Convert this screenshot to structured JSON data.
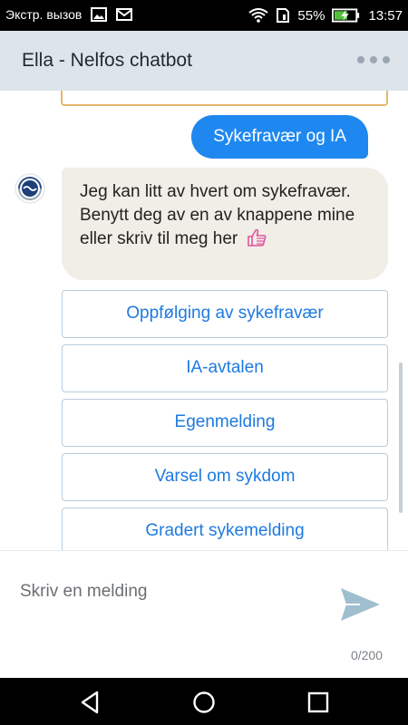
{
  "status_bar": {
    "carrier": "Экстр. вызов",
    "battery_percent": "55%",
    "time": "13:57",
    "icons": [
      "image-icon",
      "mail-icon",
      "wifi-icon",
      "sim-icon",
      "battery-charging-icon"
    ]
  },
  "header": {
    "title": "Ella - Nelfos chatbot",
    "menu_icon": "more-dots-icon"
  },
  "chat": {
    "user_message": "Sykefravær og IA",
    "bot_message": "Jeg kan litt av hvert om sykefravær. Benytt deg av en av knappene mine eller skriv til meg her",
    "bot_emoji": "thumbs-up-icon",
    "quick_replies": [
      "Oppfølging av sykefravær",
      "IA-avtalen",
      "Egenmelding",
      "Varsel om sykdom",
      "Gradert sykemelding"
    ]
  },
  "composer": {
    "placeholder": "Skriv en melding",
    "value": "",
    "counter": "0/200",
    "send_icon": "send-icon"
  },
  "nav_bar": {
    "icons": [
      "back-icon",
      "home-icon",
      "recents-icon"
    ]
  },
  "colors": {
    "accent": "#1e88f0",
    "link": "#1e7ae0",
    "header_bg": "#dde4ea",
    "bot_bubble_bg": "#f1ede7"
  }
}
